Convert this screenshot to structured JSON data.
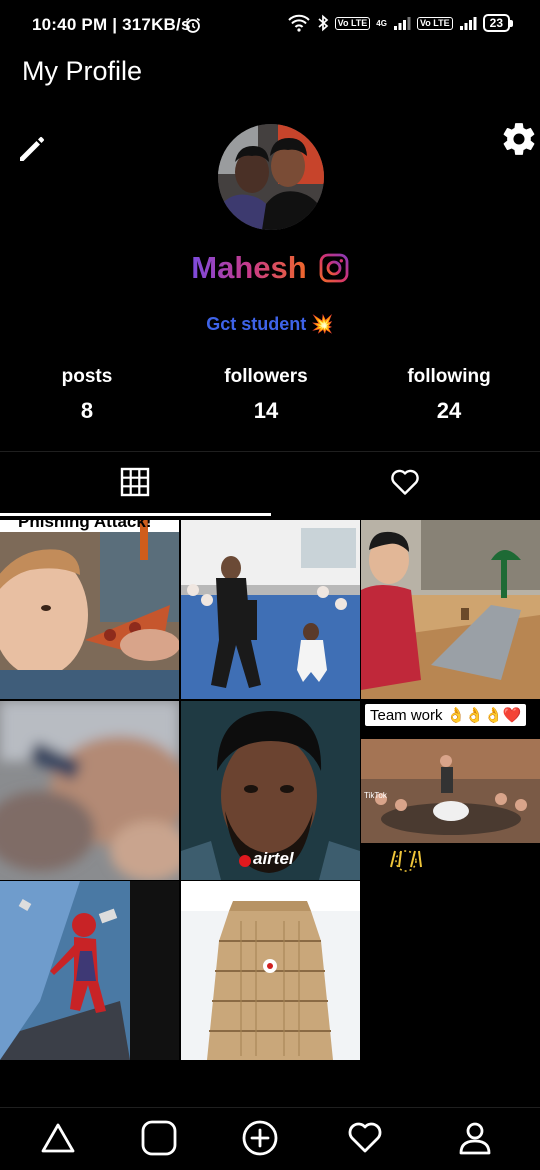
{
  "status_bar": {
    "time": "10:40 PM | 317KB/s",
    "network_label": "4G",
    "volte_1": "Vo LTE",
    "volte_2": "Vo LTE",
    "battery": "23"
  },
  "header": {
    "title": "My Profile",
    "edit_icon": "pencil-icon",
    "settings_icon": "gear-icon"
  },
  "profile": {
    "name": "Mahesh",
    "bio": "Gct student",
    "bio_emoji": "💥",
    "insta_icon": "instagram-icon"
  },
  "stats": [
    {
      "label": "posts",
      "value": "8"
    },
    {
      "label": "followers",
      "value": "14"
    },
    {
      "label": "following",
      "value": "24"
    }
  ],
  "tabs": [
    {
      "icon": "grid-icon",
      "active": true
    },
    {
      "icon": "heart-icon",
      "active": false
    }
  ],
  "posts": {
    "post1_caption": "Phishing Attack!",
    "post5_brand": "airtel",
    "post6_caption": "Team work 👌👌👌❤️",
    "post6_tiktok": "TikTok"
  },
  "bottom_nav": [
    {
      "icon": "home-triangle-icon"
    },
    {
      "icon": "search-square-icon"
    },
    {
      "icon": "add-post-icon"
    },
    {
      "icon": "activity-heart-icon"
    },
    {
      "icon": "profile-icon",
      "active": true
    }
  ]
}
